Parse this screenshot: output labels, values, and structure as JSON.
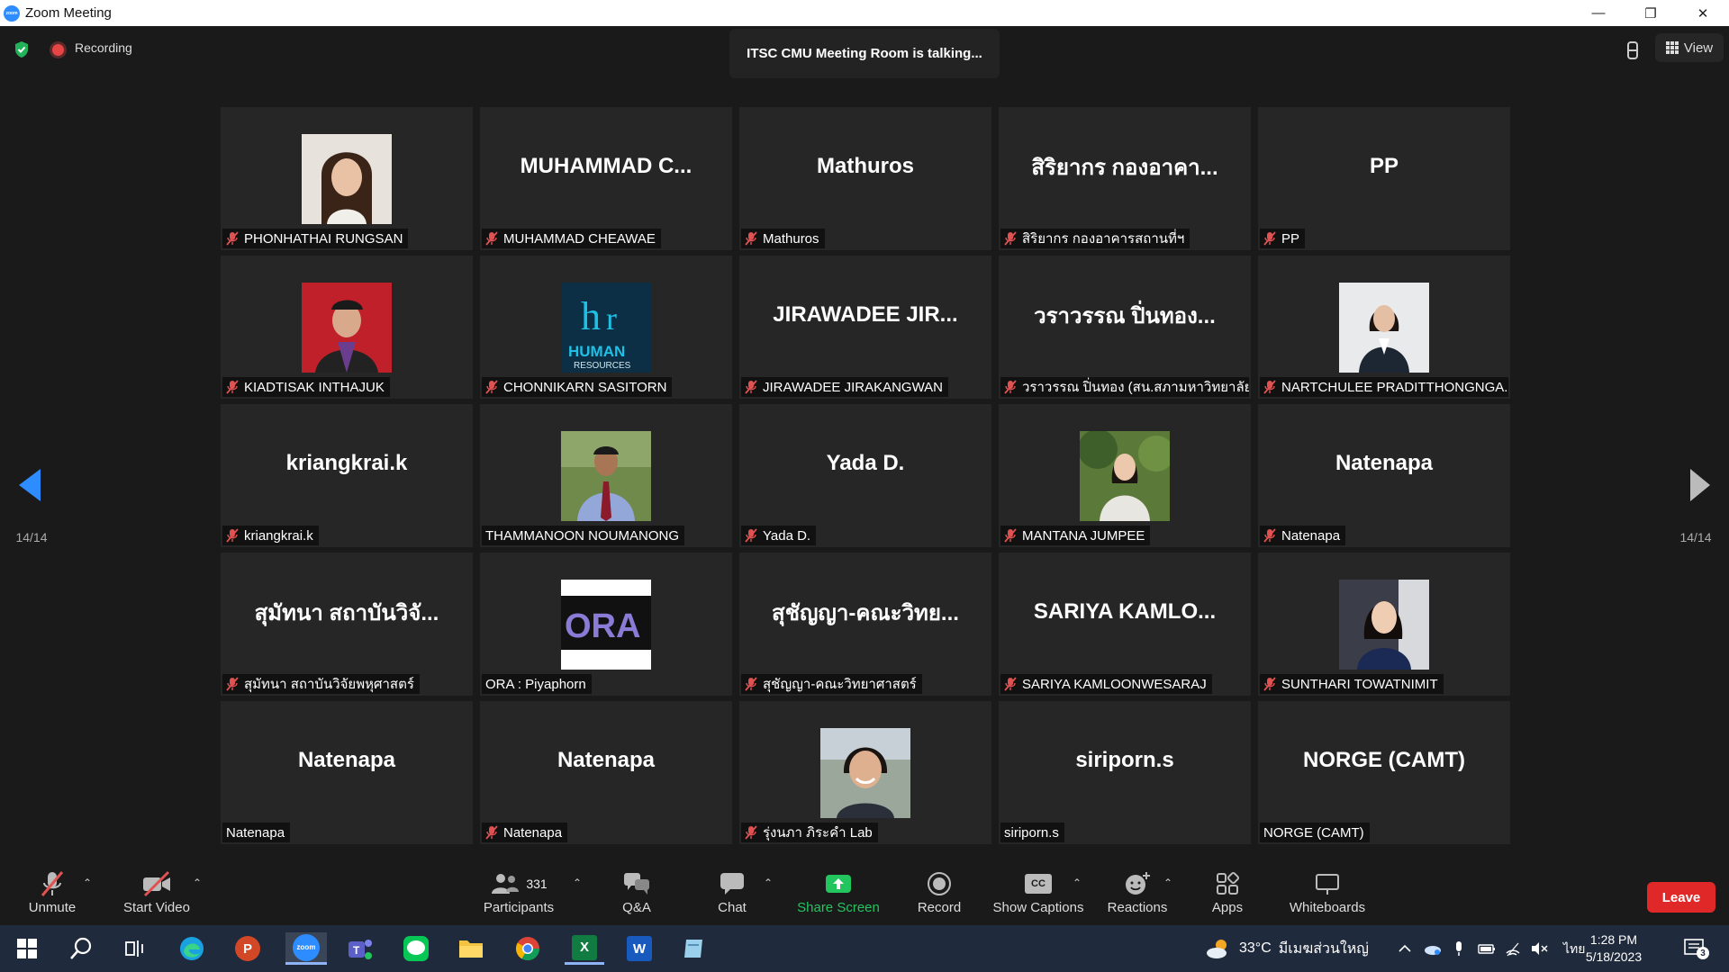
{
  "window": {
    "title": "Zoom Meeting",
    "minimize": "—",
    "restore": "❐",
    "close": "✕"
  },
  "status": {
    "recording_label": "Recording",
    "talking": "ITSC CMU Meeting Room is talking...",
    "view_label": "View"
  },
  "nav": {
    "page_left": "14/14",
    "page_right": "14/14"
  },
  "participants": [
    {
      "big": "",
      "label": "PHONHATHAI RUNGSAN",
      "muted": true,
      "photo": "woman-long-hair"
    },
    {
      "big": "MUHAMMAD  C...",
      "label": "MUHAMMAD CHEAWAE",
      "muted": true
    },
    {
      "big": "Mathuros",
      "label": "Mathuros",
      "muted": true
    },
    {
      "big": "สิริยากร กองอาคา...",
      "label": "สิริยากร กองอาคารสถานที่ฯ",
      "muted": true
    },
    {
      "big": "PP",
      "label": "PP",
      "muted": true
    },
    {
      "big": "",
      "label": "KIADTISAK INTHAJUK",
      "muted": true,
      "photo": "graduate-man"
    },
    {
      "big": "",
      "label": "CHONNIKARN SASITORN",
      "muted": true,
      "photo": "hr-logo",
      "logo_text": "HUMAN",
      "logo_sub": "RESOURCES"
    },
    {
      "big": "JIRAWADEE  JIR...",
      "label": "JIRAWADEE JIRAKANGWAN",
      "muted": true
    },
    {
      "big": "วราวรรณ ปิ่นทอง...",
      "label": "วราวรรณ ปิ่นทอง (สน.สภามหาวิทยาลัย)",
      "muted": true
    },
    {
      "big": "",
      "label": "NARTCHULEE PRADITTHONGNGA...",
      "muted": true,
      "photo": "woman-suit"
    },
    {
      "big": "kriangkrai.k",
      "label": "kriangkrai.k",
      "muted": true
    },
    {
      "big": "",
      "label": "THAMMANOON NOUMANONG",
      "muted": false,
      "photo": "man-tie"
    },
    {
      "big": "Yada D.",
      "label": "Yada D.",
      "muted": true
    },
    {
      "big": "",
      "label": "MANTANA JUMPEE",
      "muted": true,
      "photo": "woman-trees"
    },
    {
      "big": "Natenapa",
      "label": "Natenapa",
      "muted": true
    },
    {
      "big": "สุมัทนา สถาบันวิจั...",
      "label": "สุมัทนา สถาบันวิจัยพหุศาสตร์",
      "muted": true
    },
    {
      "big": "",
      "label": "ORA : Piyaphorn",
      "muted": false,
      "photo": "ora-logo",
      "logo_text": "ORA"
    },
    {
      "big": "สุชัญญา-คณะวิทย...",
      "label": "สุชัญญา-คณะวิทยาศาสตร์",
      "muted": true
    },
    {
      "big": "SARIYA  KAMLO...",
      "label": "SARIYA KAMLOONWESARAJ",
      "muted": true
    },
    {
      "big": "",
      "label": "SUNTHARI TOWATNIMIT",
      "muted": true,
      "photo": "woman-dark-hair"
    },
    {
      "big": "Natenapa",
      "label": "Natenapa",
      "muted": false
    },
    {
      "big": "Natenapa",
      "label": "Natenapa",
      "muted": true
    },
    {
      "big": "",
      "label": "รุ่งนภา ภิระคำ Lab",
      "muted": true,
      "photo": "woman-short-hair"
    },
    {
      "big": "siriporn.s",
      "label": "siriporn.s",
      "muted": false
    },
    {
      "big": "NORGE (CAMT)",
      "label": "NORGE (CAMT)",
      "muted": false
    }
  ],
  "toolbar": {
    "unmute": "Unmute",
    "start_video": "Start Video",
    "participants": "Participants",
    "participants_count": "331",
    "qa": "Q&A",
    "chat": "Chat",
    "share_screen": "Share Screen",
    "record": "Record",
    "show_captions": "Show Captions",
    "cc_badge": "CC",
    "reactions": "Reactions",
    "apps": "Apps",
    "whiteboards": "Whiteboards",
    "leave": "Leave"
  },
  "taskbar": {
    "zoom_label": "zoom",
    "excel_letter": "X",
    "word_letter": "W",
    "powerpoint_letter": "P",
    "weather_temp": "33°C",
    "weather_text": "มีเมฆส่วนใหญ่",
    "lang": "ไทย",
    "time": "1:28 PM",
    "date": "5/18/2023",
    "notif_count": "3"
  },
  "colors": {
    "accent": "#2d8cff",
    "leave": "#e02828",
    "share": "#22c55e",
    "muted_mic": "#e05252"
  }
}
